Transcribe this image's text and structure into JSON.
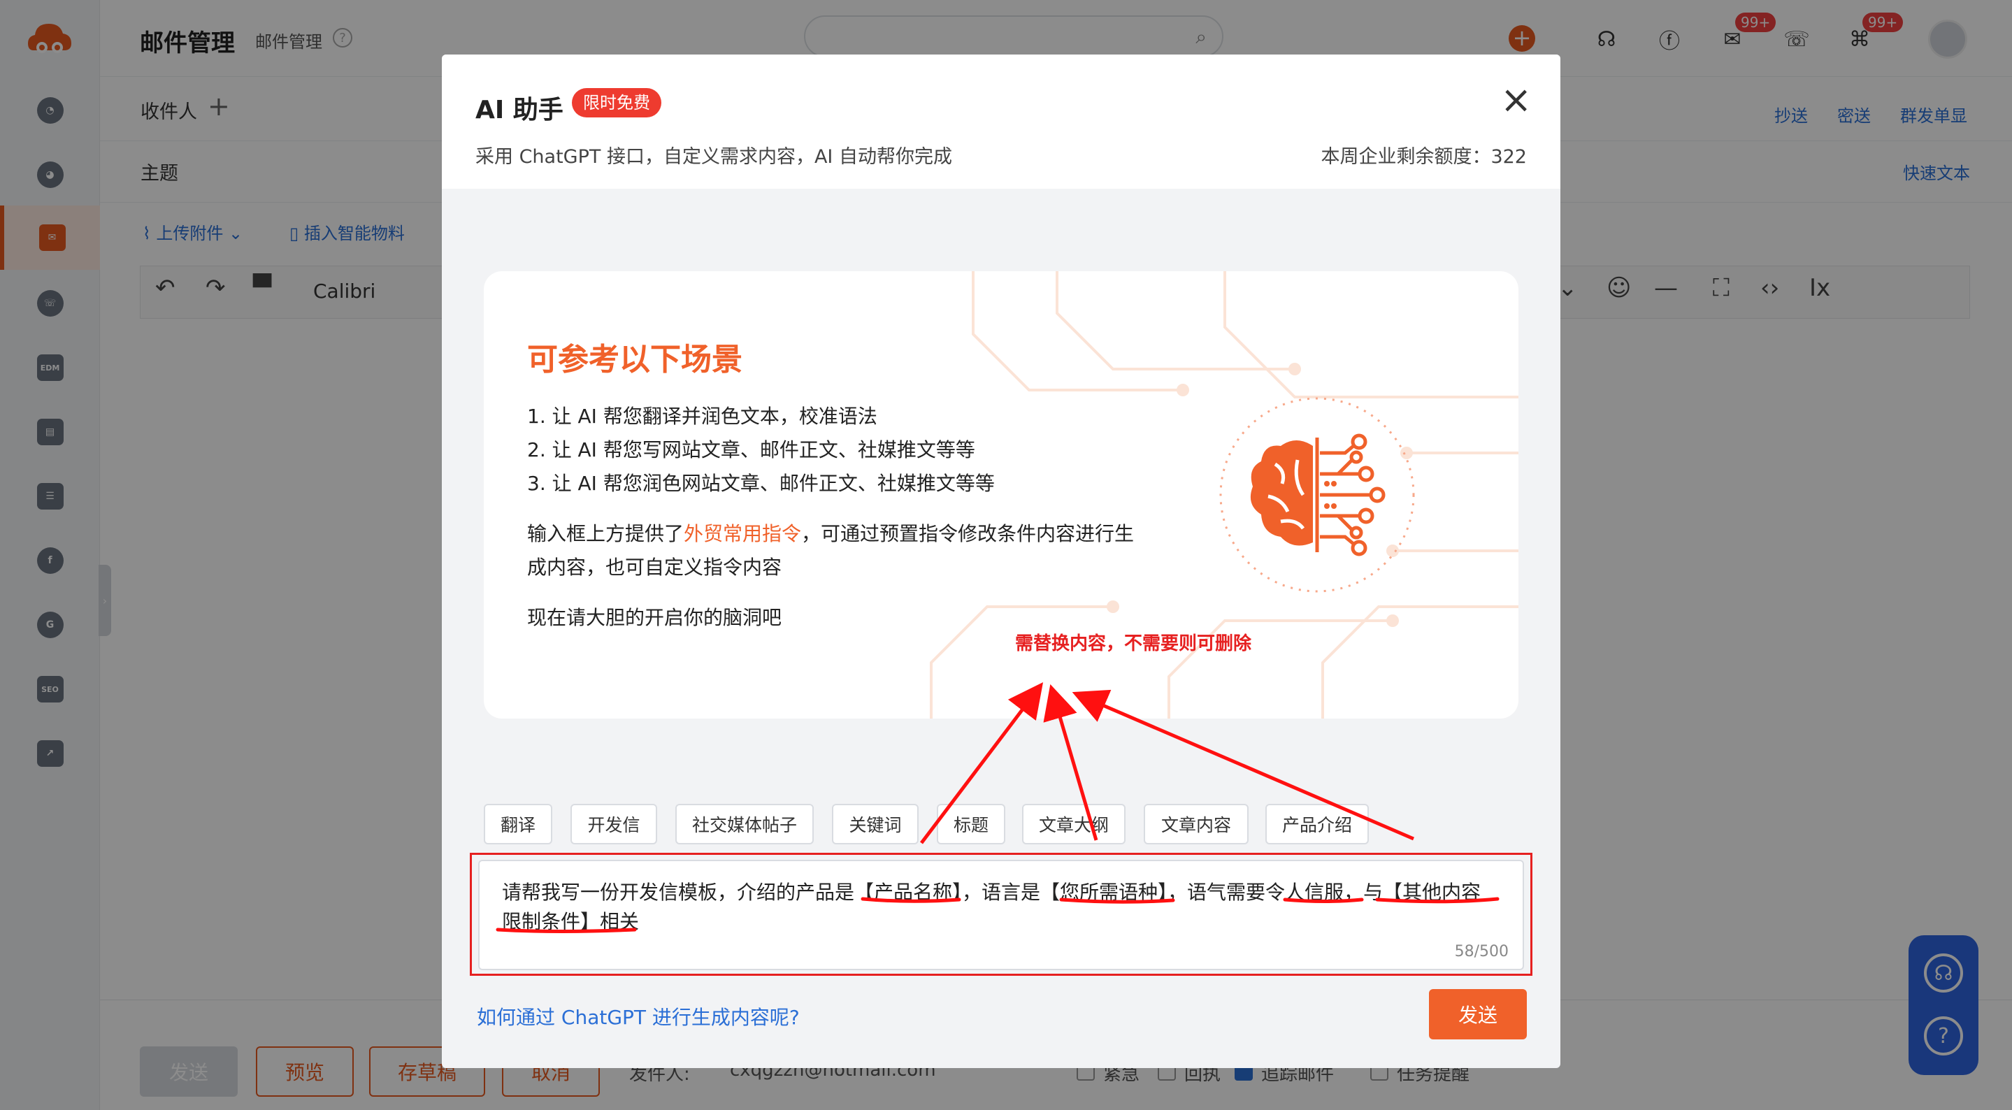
{
  "app": {
    "page_title": "邮件管理",
    "page_subtitle": "邮件管理",
    "help_icon": "?",
    "badges": [
      "99+",
      "99+"
    ]
  },
  "compose": {
    "to_label": "收件人",
    "subject_label": "主题",
    "cc": "抄送",
    "bcc": "密送",
    "bulk_single": "群发单显",
    "quick_text": "快速文本",
    "upload_attachment": "上传附件",
    "insert_material": "插入智能物料",
    "font_name": "Calibri"
  },
  "bottom": {
    "send": "发送",
    "preview": "预览",
    "save_draft": "存草稿",
    "cancel": "取消",
    "sender_label": "发件人:",
    "sender_email": "cxqgzzh@hotmail.com",
    "urgent": "紧急",
    "receipt": "回执",
    "track": "追踪邮件",
    "task_reminder": "任务提醒"
  },
  "modal": {
    "title": "AI 助手",
    "free_tag": "限时免费",
    "description": "采用 ChatGPT 接口，自定义需求内容，AI 自动帮你完成",
    "quota": "本周企业剩余额度：322",
    "card": {
      "heading": "可参考以下场景",
      "items": [
        "1. 让 AI 帮您翻译并润色文本，校准语法",
        "2. 让 AI 帮您写网站文章、邮件正文、社媒推文等等",
        "3. 让 AI 帮您润色网站文章、邮件正文、社媒推文等等"
      ],
      "para_prefix": "输入框上方提供了",
      "para_highlight": "外贸常用指令",
      "para_suffix_1": "，可通过预置指令修改条件内容进行生",
      "para_suffix_2": "成内容，也可自定义指令内容",
      "closing": "现在请大胆的开启你的脑洞吧"
    },
    "annotation": "需替换内容，不需要则可删除",
    "prompt_tags": [
      "翻译",
      "开发信",
      "社交媒体帖子",
      "关键词",
      "标题",
      "文章大纲",
      "文章内容",
      "产品介绍"
    ],
    "input_line1": "请帮我写一份开发信模板，介绍的产品是【产品名称】，语言是【您所需语种】，语气需要令人信服，与【其他内容",
    "input_line2": "限制条件】相关",
    "counter": "58/500",
    "how_link": "如何通过 ChatGPT 进行生成内容呢?",
    "send": "发送",
    "close_icon": "×"
  },
  "colors": {
    "brand": "#e85a20",
    "accent_orange": "#f0612a",
    "link_blue": "#2b6fd6",
    "annotation_red": "#e62020",
    "tag_red": "#ee3b2f"
  }
}
